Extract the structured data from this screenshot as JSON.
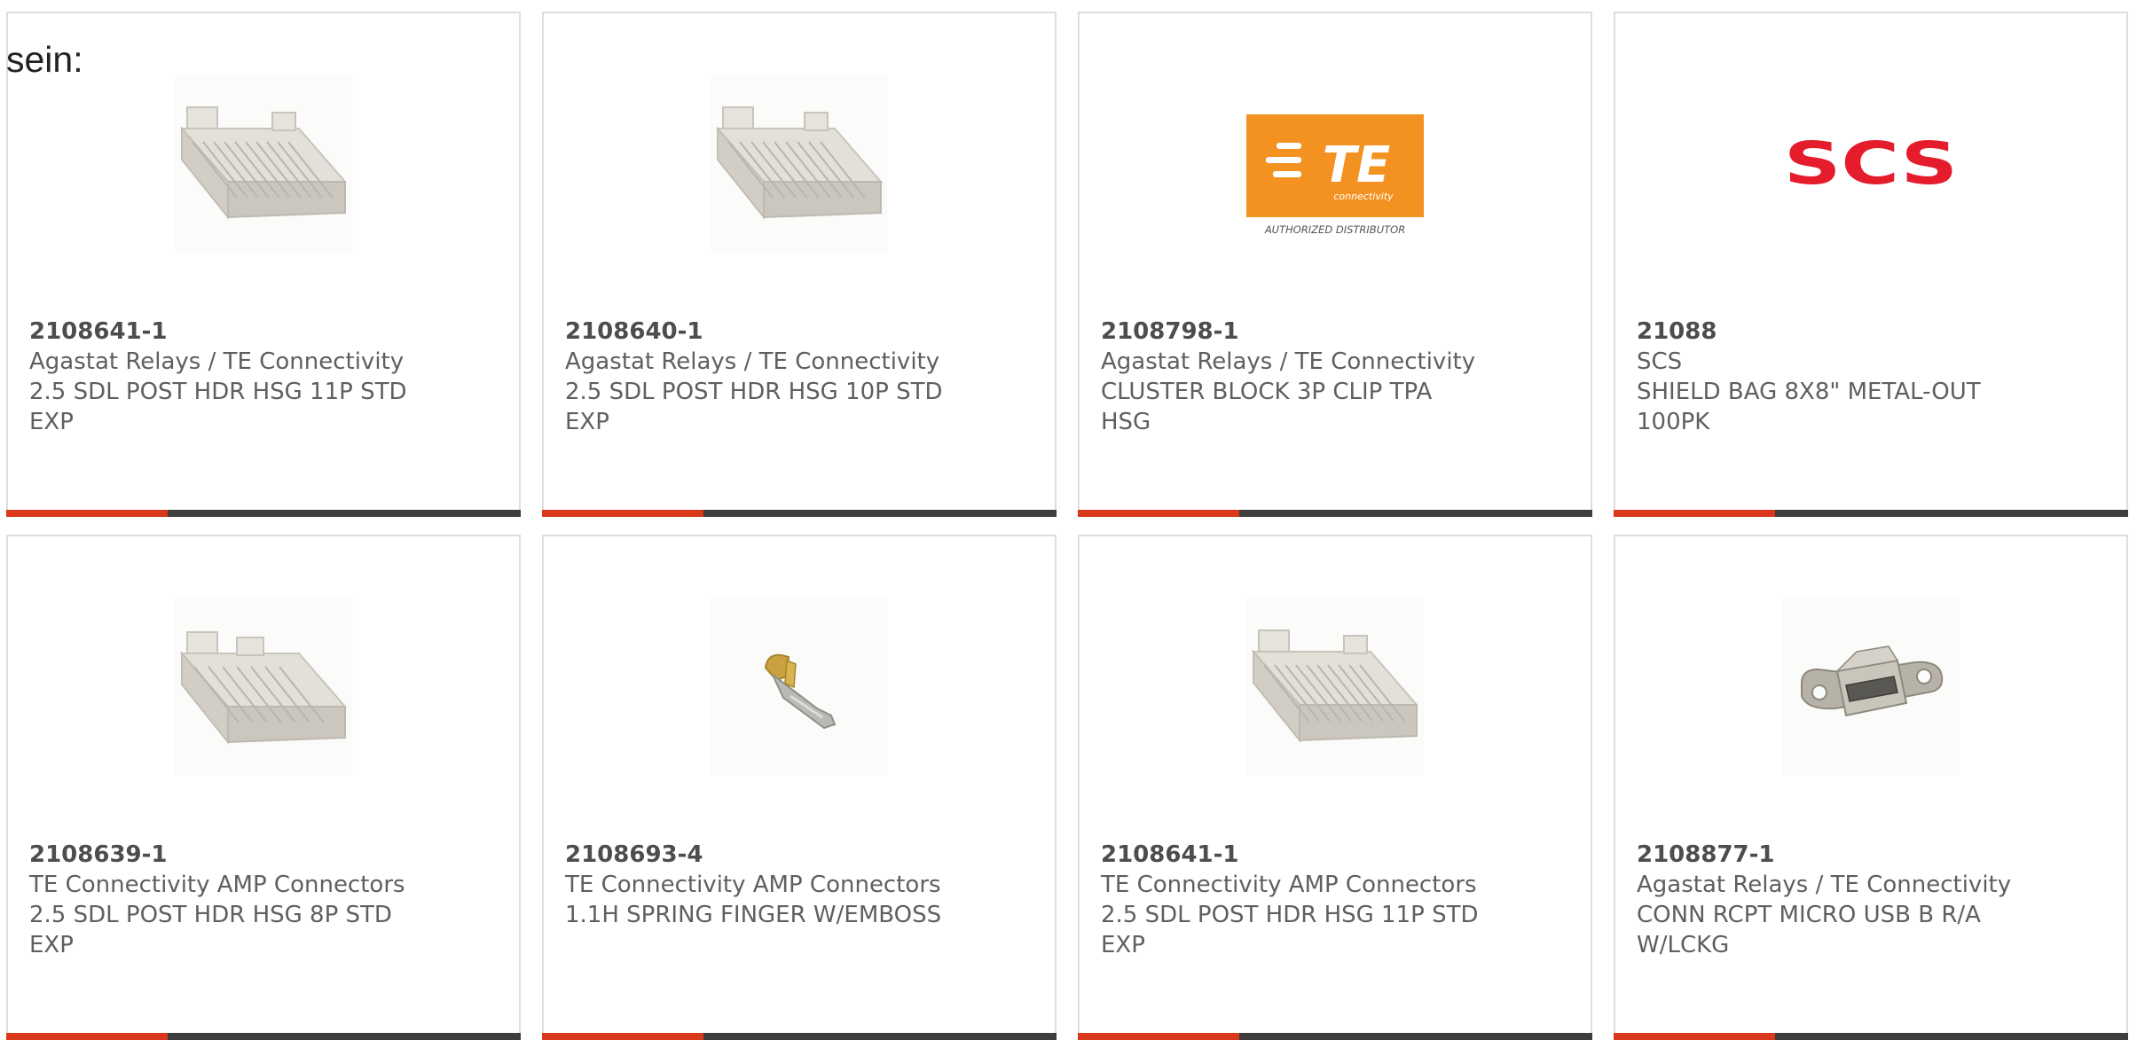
{
  "intro_text": "sein:",
  "colors": {
    "accent": "#d9391a",
    "bar": "#3d3d3d",
    "te_orange": "#f39221",
    "scs_red": "#e41c2c"
  },
  "cards": [
    {
      "part_number": "2108641-1",
      "manufacturer": "Agastat Relays / TE Connectivity",
      "description": "2.5 SDL POST HDR HSG 11P STD\nEXP",
      "image": "connector-housing-icon"
    },
    {
      "part_number": "2108640-1",
      "manufacturer": "Agastat Relays / TE Connectivity",
      "description": "2.5 SDL POST HDR HSG 10P STD\nEXP",
      "image": "connector-housing-icon"
    },
    {
      "part_number": "2108798-1",
      "manufacturer": "Agastat Relays / TE Connectivity",
      "description": "CLUSTER BLOCK 3P CLIP TPA\nHSG",
      "image": "te-logo",
      "logo_text": "TE",
      "logo_subtext": "connectivity",
      "logo_caption": "AUTHORIZED DISTRIBUTOR"
    },
    {
      "part_number": "21088",
      "manufacturer": "SCS",
      "description": "SHIELD BAG 8X8\" METAL-OUT\n100PK",
      "image": "scs-logo",
      "logo_text": "SCS"
    },
    {
      "part_number": "2108639-1",
      "manufacturer": "TE Connectivity AMP Connectors",
      "description": "2.5 SDL POST HDR HSG 8P STD\nEXP",
      "image": "connector-housing-icon"
    },
    {
      "part_number": "2108693-4",
      "manufacturer": "TE Connectivity AMP Connectors",
      "description": "1.1H SPRING FINGER W/EMBOSS",
      "image": "spring-finger-icon"
    },
    {
      "part_number": "2108641-1",
      "manufacturer": "TE Connectivity AMP Connectors",
      "description": "2.5 SDL POST HDR HSG 11P STD\nEXP",
      "image": "connector-housing-icon"
    },
    {
      "part_number": "2108877-1",
      "manufacturer": "Agastat Relays / TE Connectivity",
      "description": "CONN RCPT MICRO USB B R/A\nW/LCKG",
      "image": "usb-receptacle-icon"
    }
  ]
}
